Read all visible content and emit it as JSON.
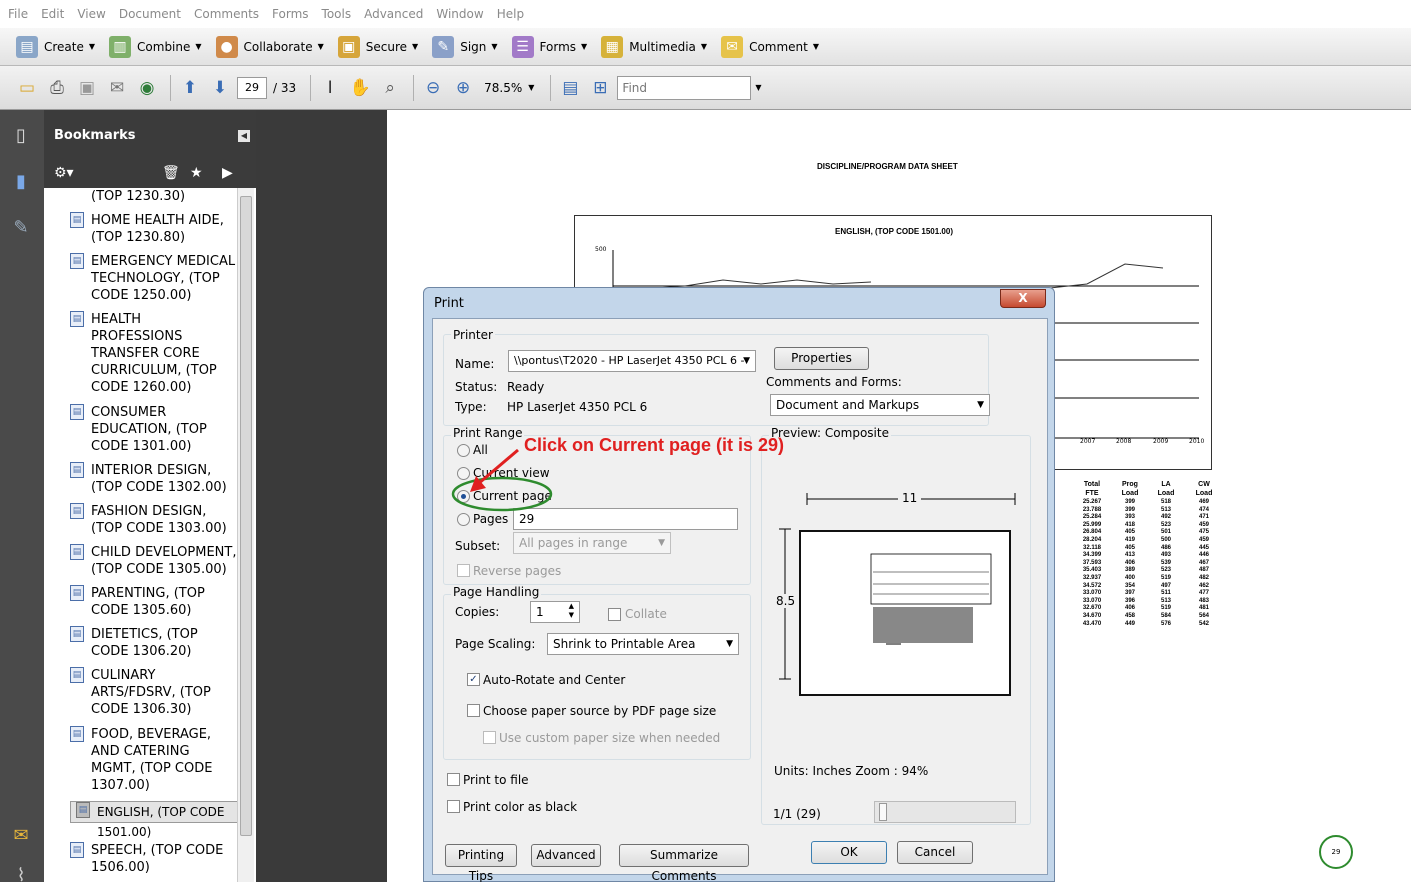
{
  "menu": [
    "File",
    "Edit",
    "View",
    "Document",
    "Comments",
    "Forms",
    "Tools",
    "Advanced",
    "Window",
    "Help"
  ],
  "toolbar": {
    "create": "Create",
    "combine": "Combine",
    "collaborate": "Collaborate",
    "secure": "Secure",
    "sign": "Sign",
    "forms": "Forms",
    "multimedia": "Multimedia",
    "comment": "Comment"
  },
  "nav": {
    "page": "29",
    "total": "/ 33",
    "zoom": "78.5%",
    "find_placeholder": "Find"
  },
  "bookmarks": {
    "title": "Bookmarks",
    "items": [
      "(TOP 1230.30)",
      "HOME HEALTH AIDE,\n(TOP 1230.80)",
      "EMERGENCY MEDICAL\nTECHNOLOGY, (TOP\nCODE 1250.00)",
      "HEALTH\nPROFESSIONS\nTRANSFER CORE\nCURRICULUM, (TOP\nCODE 1260.00)",
      "CONSUMER\nEDUCATION, (TOP\nCODE 1301.00)",
      "INTERIOR DESIGN,\n(TOP CODE 1302.00)",
      "FASHION DESIGN,\n(TOP CODE 1303.00)",
      "CHILD DEVELOPMENT,\n(TOP CODE 1305.00)",
      "PARENTING, (TOP\nCODE 1305.60)",
      "DIETETICS, (TOP\nCODE 1306.20)",
      "CULINARY\nARTS/FDSRV, (TOP\nCODE 1306.30)",
      "FOOD, BEVERAGE,\nAND CATERING\nMGMT, (TOP CODE\n1307.00)",
      "ENGLISH, (TOP CODE\n1501.00)",
      "SPEECH, (TOP CODE\n1506.00)"
    ]
  },
  "document": {
    "title": "DISCIPLINE/PROGRAM DATA SHEET",
    "chart_title": "ENGLISH, (TOP CODE 1501.00)",
    "y_tick": "500",
    "years": [
      "2007",
      "2008",
      "2009",
      "2010"
    ],
    "table_headers": [
      "Total\nFTE",
      "Prog\nLoad",
      "LA\nLoad",
      "CW\nLoad"
    ],
    "table_rows": [
      [
        "25.267",
        "399",
        "518",
        "469"
      ],
      [
        "23.788",
        "399",
        "513",
        "474"
      ],
      [
        "25.284",
        "393",
        "492",
        "471"
      ],
      [
        "25.999",
        "418",
        "523",
        "459"
      ],
      [
        "26.804",
        "405",
        "501",
        "475"
      ],
      [
        "28.204",
        "419",
        "500",
        "459"
      ],
      [
        "32.118",
        "405",
        "486",
        "445"
      ],
      [
        "34.399",
        "413",
        "493",
        "446"
      ],
      [
        "37.593",
        "406",
        "539",
        "467"
      ],
      [
        "35.403",
        "389",
        "523",
        "487"
      ],
      [
        "32.937",
        "400",
        "519",
        "482"
      ],
      [
        "34.572",
        "354",
        "497",
        "462"
      ],
      [
        "33.070",
        "397",
        "511",
        "477"
      ],
      [
        "33.070",
        "396",
        "513",
        "483"
      ],
      [
        "32.670",
        "406",
        "519",
        "481"
      ],
      [
        "34.670",
        "458",
        "584",
        "564"
      ],
      [
        "43.470",
        "449",
        "576",
        "542"
      ]
    ],
    "page_number": "29"
  },
  "print": {
    "title": "Print",
    "close": "X",
    "printer_group": "Printer",
    "name_label": "Name:",
    "name_value": "\\\\pontus\\T2020 - HP LaserJet 4350 PCL 6 -",
    "status_label": "Status:",
    "status_value": "Ready",
    "type_label": "Type:",
    "type_value": "HP LaserJet 4350 PCL 6",
    "properties": "Properties",
    "comments_forms_label": "Comments and Forms:",
    "comments_forms_value": "Document and Markups",
    "range_group": "Print Range",
    "all": "All",
    "current_view": "Current view",
    "current_page": "Current page",
    "pages": "Pages",
    "pages_value": "29",
    "subset_label": "Subset:",
    "subset_value": "All pages in range",
    "reverse": "Reverse pages",
    "handling_group": "Page Handling",
    "copies_label": "Copies:",
    "copies_value": "1",
    "collate": "Collate",
    "scaling_label": "Page Scaling:",
    "scaling_value": "Shrink to Printable Area",
    "auto_rotate": "Auto-Rotate and Center",
    "paper_source": "Choose paper source by PDF page size",
    "custom_paper": "Use custom paper size when needed",
    "print_to_file": "Print to file",
    "print_black": "Print color as black",
    "preview_label": "Preview: Composite",
    "width_label": "11",
    "height_label": "8.5",
    "units": "Units: Inches Zoom :  94%",
    "page_indicator": "1/1 (29)",
    "printing_tips": "Printing Tips",
    "advanced": "Advanced",
    "summarize": "Summarize Comments",
    "ok": "OK",
    "cancel": "Cancel"
  },
  "annotation": "Click on Current page (it is 29)",
  "colors": {
    "annotation": "#e02020",
    "highlight_circle": "#2e8b2e"
  }
}
